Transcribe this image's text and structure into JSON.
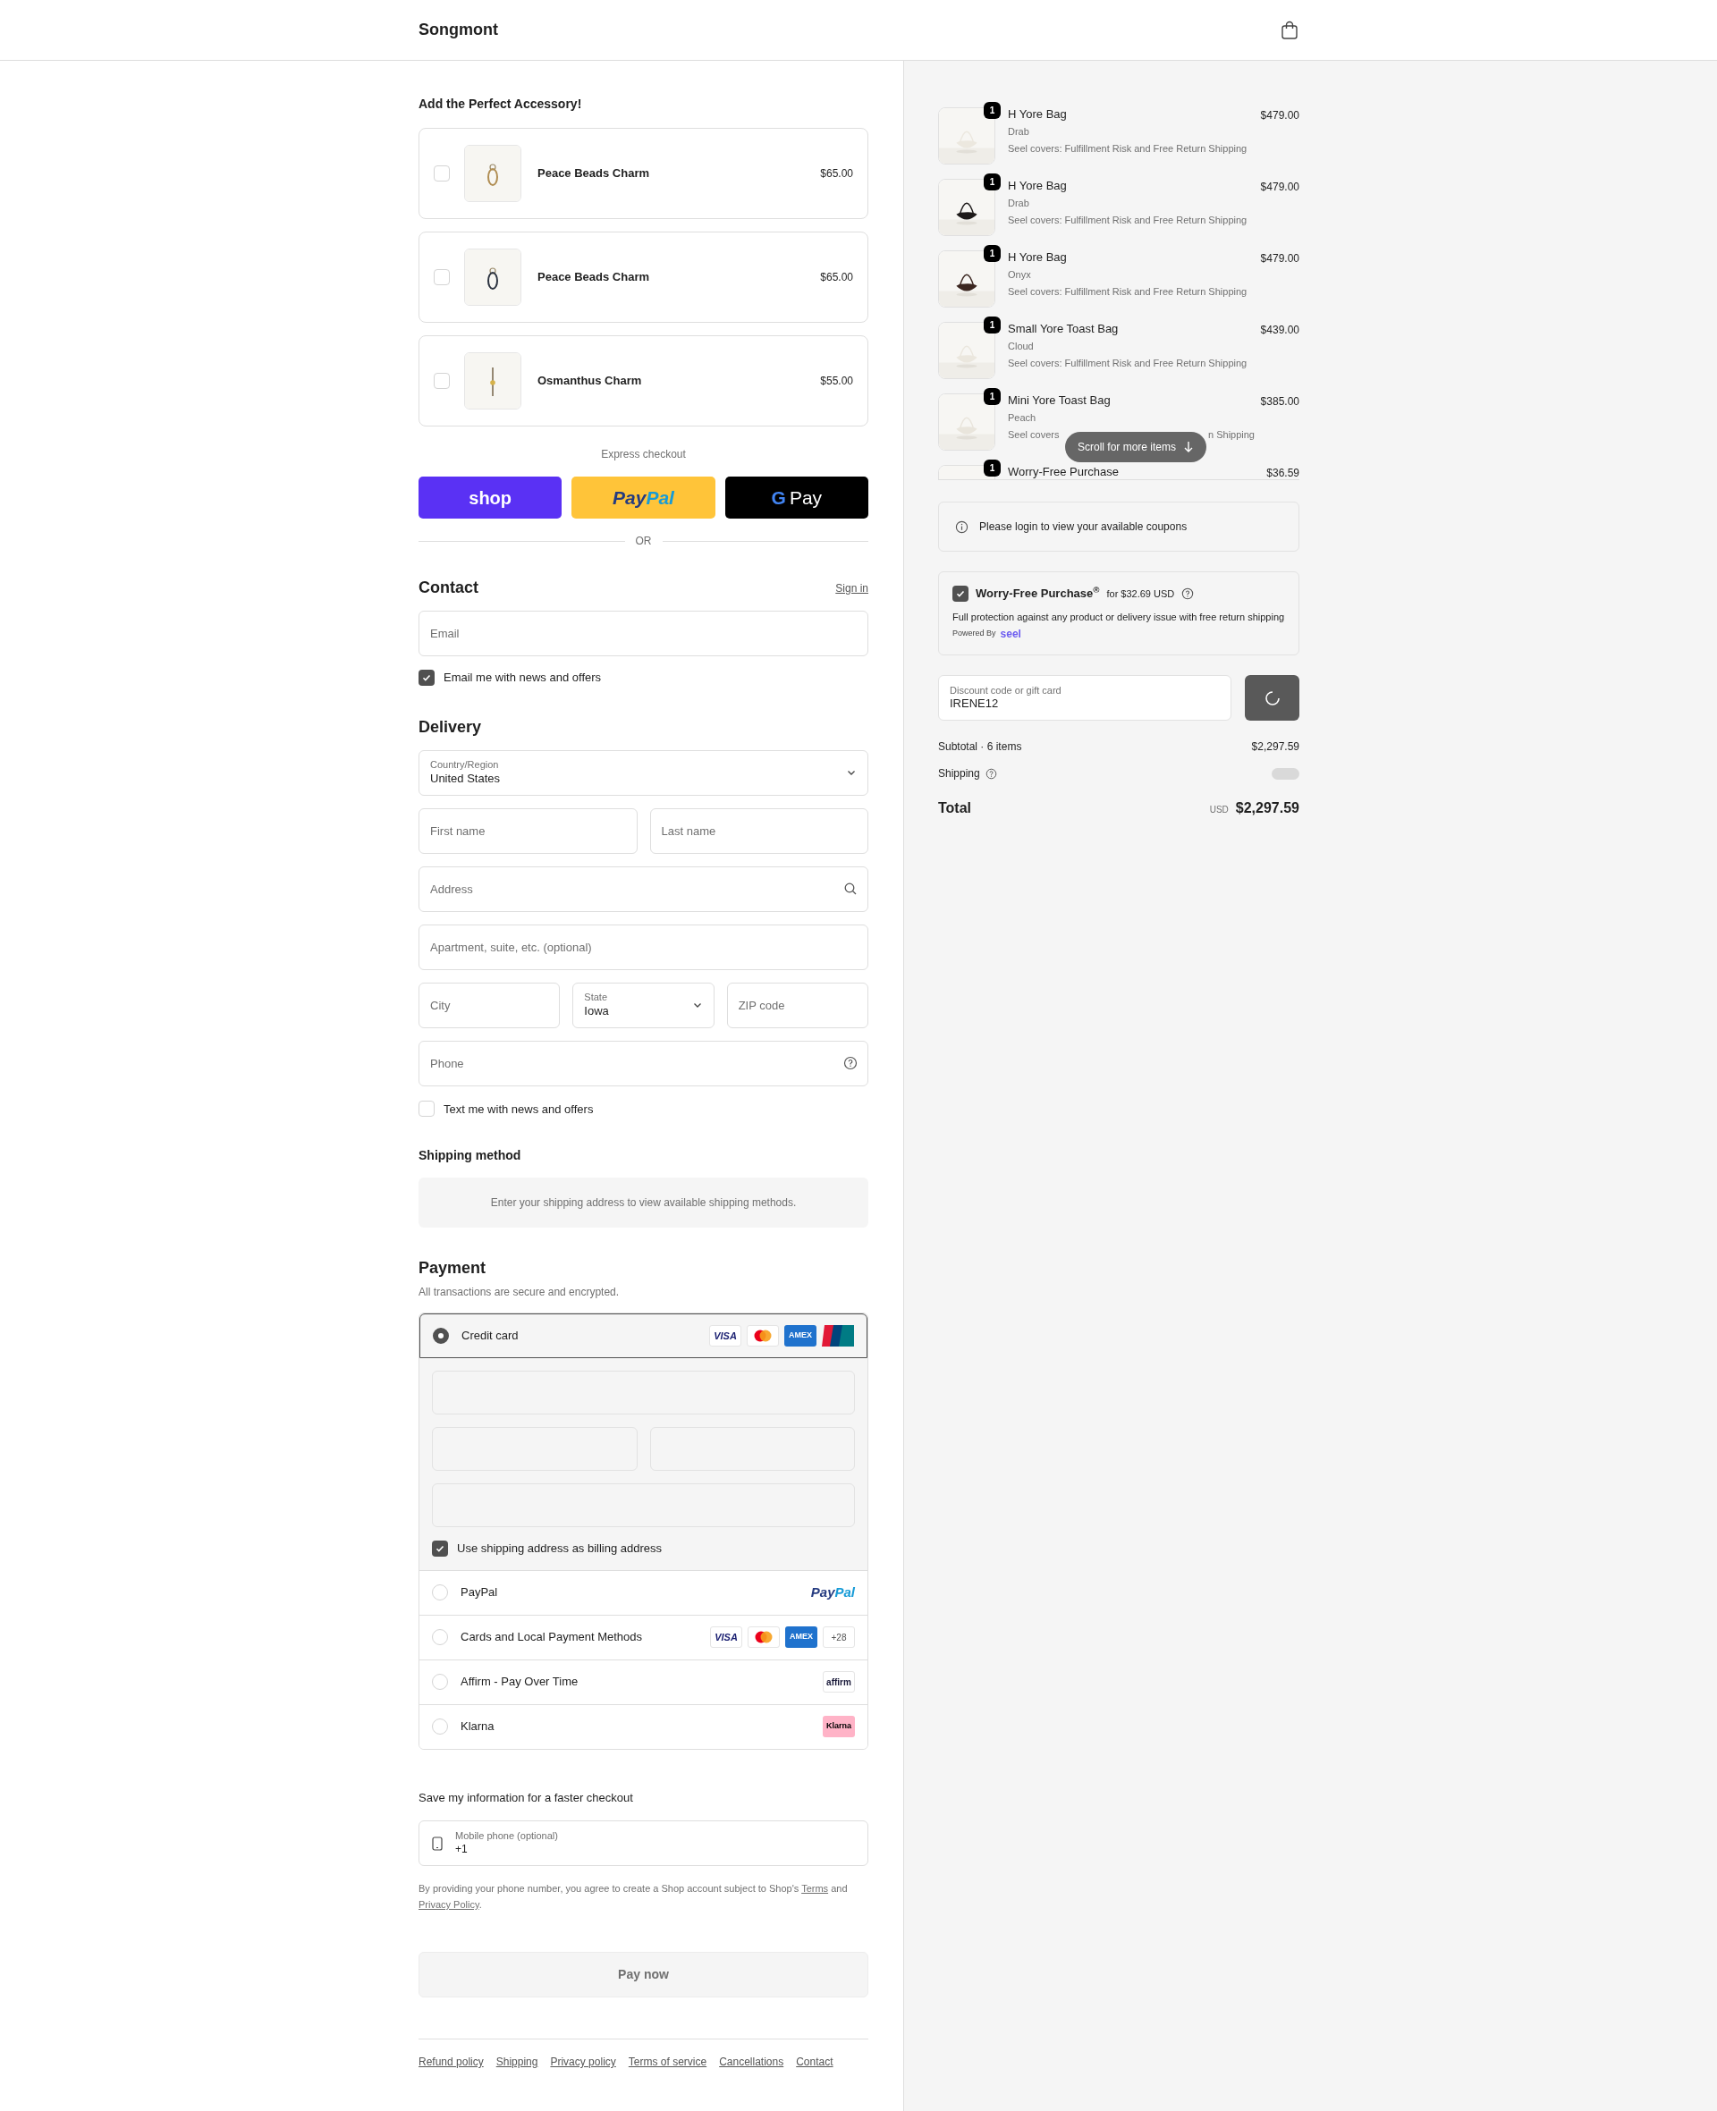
{
  "header": {
    "logo": "Songmont"
  },
  "upsell": {
    "title": "Add the Perfect Accessory!",
    "items": [
      {
        "name": "Peace Beads Charm",
        "price": "$65.00",
        "checked": false
      },
      {
        "name": "Peace Beads Charm",
        "price": "$65.00",
        "checked": false
      },
      {
        "name": "Osmanthus Charm",
        "price": "$55.00",
        "checked": false
      }
    ]
  },
  "express": {
    "label": "Express checkout",
    "buttons": [
      {
        "kind": "shop",
        "text": "shop"
      },
      {
        "kind": "paypal",
        "parts": [
          "Pay",
          "Pal"
        ]
      },
      {
        "kind": "gpay",
        "g": "G",
        "text": "Pay"
      }
    ],
    "divider": "OR"
  },
  "contact": {
    "title": "Contact",
    "sign_in": "Sign in",
    "email_placeholder": "Email",
    "news": {
      "label": "Email me with news and offers",
      "checked": true
    }
  },
  "delivery": {
    "title": "Delivery",
    "rows": [
      [
        {
          "kind": "select",
          "label": "Country/Region",
          "value": "United States"
        }
      ],
      [
        {
          "kind": "text",
          "placeholder": "First name"
        },
        {
          "kind": "text",
          "placeholder": "Last name"
        }
      ],
      [
        {
          "kind": "search",
          "placeholder": "Address"
        }
      ],
      [
        {
          "kind": "text",
          "placeholder": "Apartment, suite, etc. (optional)"
        }
      ],
      [
        {
          "kind": "text",
          "placeholder": "City"
        },
        {
          "kind": "select",
          "label": "State",
          "value": "Iowa"
        },
        {
          "kind": "text",
          "placeholder": "ZIP code"
        }
      ],
      [
        {
          "kind": "help",
          "placeholder": "Phone"
        }
      ]
    ],
    "sms": {
      "label": "Text me with news and offers",
      "checked": false
    }
  },
  "shipping_method": {
    "title": "Shipping method",
    "notice": "Enter your shipping address to view available shipping methods."
  },
  "payment": {
    "title": "Payment",
    "subtitle": "All transactions are secure and encrypted.",
    "methods": [
      {
        "label": "Credit card",
        "selected": true,
        "logos": [
          {
            "kind": "visa",
            "text": "VISA"
          },
          {
            "kind": "mastercard"
          },
          {
            "kind": "amex",
            "text": "AMEX"
          },
          {
            "kind": "unionpay"
          }
        ]
      },
      {
        "label": "PayPal",
        "selected": false,
        "logos": [
          {
            "kind": "paypal",
            "parts": [
              "Pay",
              "Pal"
            ]
          }
        ]
      },
      {
        "label": "Cards and Local Payment Methods",
        "selected": false,
        "logos": [
          {
            "kind": "visa",
            "text": "VISA"
          },
          {
            "kind": "mastercard"
          },
          {
            "kind": "amex",
            "text": "AMEX"
          },
          {
            "kind": "more",
            "text": "+28"
          }
        ]
      },
      {
        "label": "Affirm - Pay Over Time",
        "selected": false,
        "logos": [
          {
            "kind": "affirm",
            "text": "affirm"
          }
        ]
      },
      {
        "label": "Klarna",
        "selected": false,
        "logos": [
          {
            "kind": "klarna",
            "text": "Klarna"
          }
        ]
      }
    ],
    "billing": {
      "label": "Use shipping address as billing address",
      "checked": true
    }
  },
  "save": {
    "title": "Save my information for a faster checkout",
    "phone_label": "Mobile phone (optional)",
    "phone_value": "+1",
    "disclaimer": "By providing your phone number, you agree to create a Shop account subject to Shop's",
    "terms": "Terms",
    "and": "and",
    "privacy": "Privacy Policy",
    "end": "."
  },
  "pay_button": "Pay now",
  "footer_links": [
    "Refund policy",
    "Shipping",
    "Privacy policy",
    "Terms of service",
    "Cancellations",
    "Contact"
  ],
  "summary": {
    "items": [
      {
        "qty": "1",
        "name": "H Yore Bag",
        "variant": "Drab",
        "note": "Seel covers: Fulfillment Risk and Free Return Shipping",
        "price": "$479.00"
      },
      {
        "qty": "1",
        "name": "H Yore Bag",
        "variant": "Drab",
        "note": "Seel covers: Fulfillment Risk and Free Return Shipping",
        "price": "$479.00"
      },
      {
        "qty": "1",
        "name": "H Yore Bag",
        "variant": "Onyx",
        "note": "Seel covers: Fulfillment Risk and Free Return Shipping",
        "price": "$479.00"
      },
      {
        "qty": "1",
        "name": "Small Yore Toast Bag",
        "variant": "Cloud",
        "note": "Seel covers: Fulfillment Risk and Free Return Shipping",
        "price": "$439.00"
      },
      {
        "qty": "1",
        "name": "Mini Yore Toast Bag",
        "variant": "Peach",
        "note_parts": [
          "Seel covers",
          "n Shipping"
        ],
        "price": "$385.00"
      },
      {
        "qty": "1",
        "name": "Worry-Free Purchase",
        "price": "$36.59"
      }
    ],
    "scroll_hint": "Scroll for more items",
    "coupons": "Please login to view your available coupons",
    "protection": {
      "checked": true,
      "title": "Worry-Free Purchase$^{®}$",
      "price": "for $32.69 USD",
      "description": "Full protection against any product or delivery issue with free return shipping",
      "powered": "Powered By",
      "brand": "seel"
    },
    "discount": {
      "label": "Discount code or gift card",
      "value": "IRENE12"
    },
    "subtotal_label": "Subtotal · 6 items",
    "subtotal": "$2,297.59",
    "shipping_label": "Shipping",
    "total_label": "Total",
    "currency": "USD",
    "total": "$2,297.59"
  }
}
